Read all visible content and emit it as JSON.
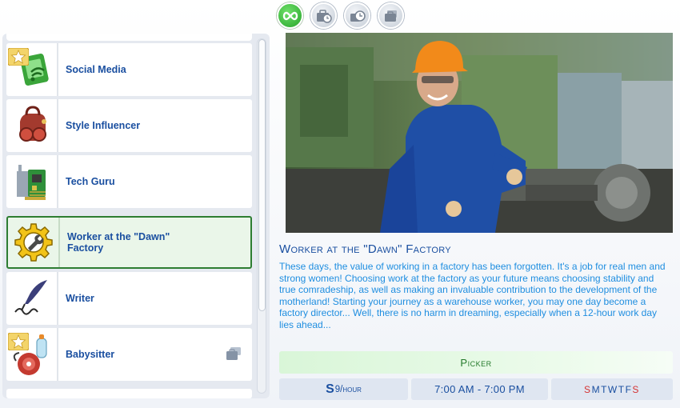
{
  "top_buttons": [
    {
      "icon": "infinity-icon",
      "state": "active",
      "color": "#2fa832"
    },
    {
      "icon": "clock-briefcase-icon",
      "state": "inactive"
    },
    {
      "icon": "alarm-clock-icon",
      "state": "inactive"
    },
    {
      "icon": "briefcase-stack-icon",
      "state": "inactive"
    }
  ],
  "career_list": {
    "items": [
      {
        "label": "Social Media",
        "icon": "social-media-icon",
        "badge": "star-badge-icon"
      },
      {
        "label": "Style Influencer",
        "icon": "style-influencer-icon"
      },
      {
        "label": "Tech Guru",
        "icon": "circuit-board-icon"
      },
      {
        "label": "Worker at the \"Dawn\"\nFactory",
        "icon": "gear-wrench-icon",
        "selected": true
      },
      {
        "label": "Writer",
        "icon": "quill-pen-icon"
      },
      {
        "label": "Babysitter",
        "icon": "babysitter-icon",
        "badge": "star-badge-icon",
        "extra_icon": "part-time-icon"
      }
    ]
  },
  "detail": {
    "title": "Worker at the \"Dawn\" Factory",
    "description": "These days, the value of working in a factory has been forgotten. It's a job for real men and strong women! Choosing work at the factory as your future means choosing stability and true comradeship, as well as making an invaluable contribution to the development of the motherland! Starting your journey as a warehouse worker, you may one day become a factory director... Well, there is no harm in dreaming, especially when a 12-hour work day lies ahead...",
    "image": "factory-worker-photo",
    "picker_label": "Picker",
    "pay": {
      "symbol": "S",
      "amount": "9/hour"
    },
    "hours": "7:00  AM - 7:00  PM",
    "days": [
      {
        "d": "S",
        "works": false
      },
      {
        "d": "M",
        "works": true
      },
      {
        "d": "T",
        "works": true
      },
      {
        "d": "W",
        "works": true
      },
      {
        "d": "T",
        "works": true
      },
      {
        "d": "F",
        "works": true
      },
      {
        "d": "S",
        "works": false
      }
    ]
  },
  "colors": {
    "accent_blue": "#1a4fa0",
    "desc_blue": "#1f8ee0",
    "selection_green": "#2e7d32",
    "off_day_red": "#d43232"
  }
}
